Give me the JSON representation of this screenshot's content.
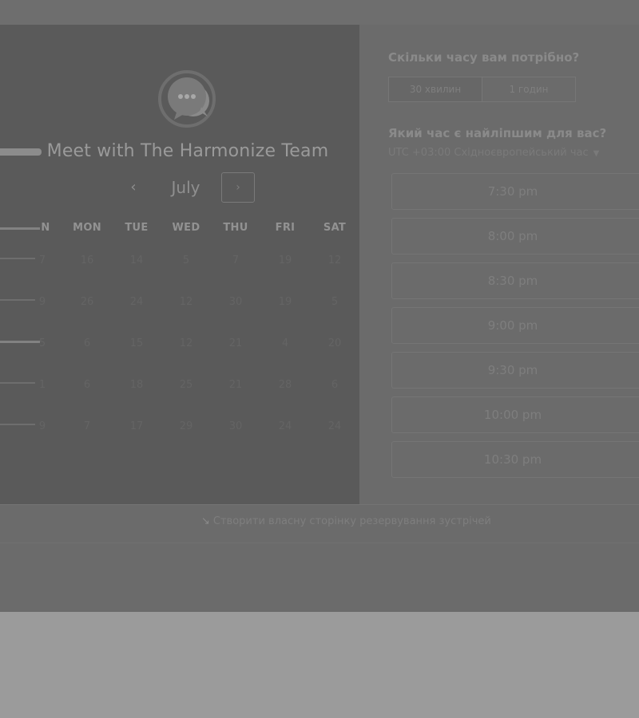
{
  "meeting": {
    "title": "Meet with The Harmonize Team"
  },
  "calendar": {
    "month": "July",
    "prev_icon": "chevron-left-icon",
    "next_icon": "chevron-right-icon",
    "weekdays": [
      "N",
      "MON",
      "TUE",
      "WED",
      "THU",
      "FRI",
      "SAT"
    ],
    "rows": [
      [
        "7",
        "16",
        "14",
        "5",
        "7",
        "19",
        "12"
      ],
      [
        "9",
        "26",
        "24",
        "12",
        "30",
        "19",
        "5"
      ],
      [
        "5",
        "6",
        "15",
        "12",
        "21",
        "4",
        "20"
      ],
      [
        "1",
        "6",
        "18",
        "25",
        "21",
        "28",
        "6"
      ],
      [
        "9",
        "7",
        "17",
        "29",
        "30",
        "24",
        "24"
      ]
    ]
  },
  "booking": {
    "duration_question": "Скільки часу вам потрібно?",
    "duration_options": [
      "30 хвилин",
      "1 годин"
    ],
    "time_question": "Який час є найліпшим для вас?",
    "timezone": "UTC +03:00 Східноєвропейський час",
    "slots": [
      "7:30 pm",
      "8:00 pm",
      "8:30 pm",
      "9:00 pm",
      "9:30 pm",
      "10:00 pm",
      "10:30 pm"
    ]
  },
  "footer": {
    "link_text": "Створити власну сторінку резервування зустрічей"
  },
  "colors": {
    "page_bg": "#9b9b9b",
    "overlay_bg": "#6b6b6b",
    "left_panel_bg": "#5a5a5a"
  }
}
